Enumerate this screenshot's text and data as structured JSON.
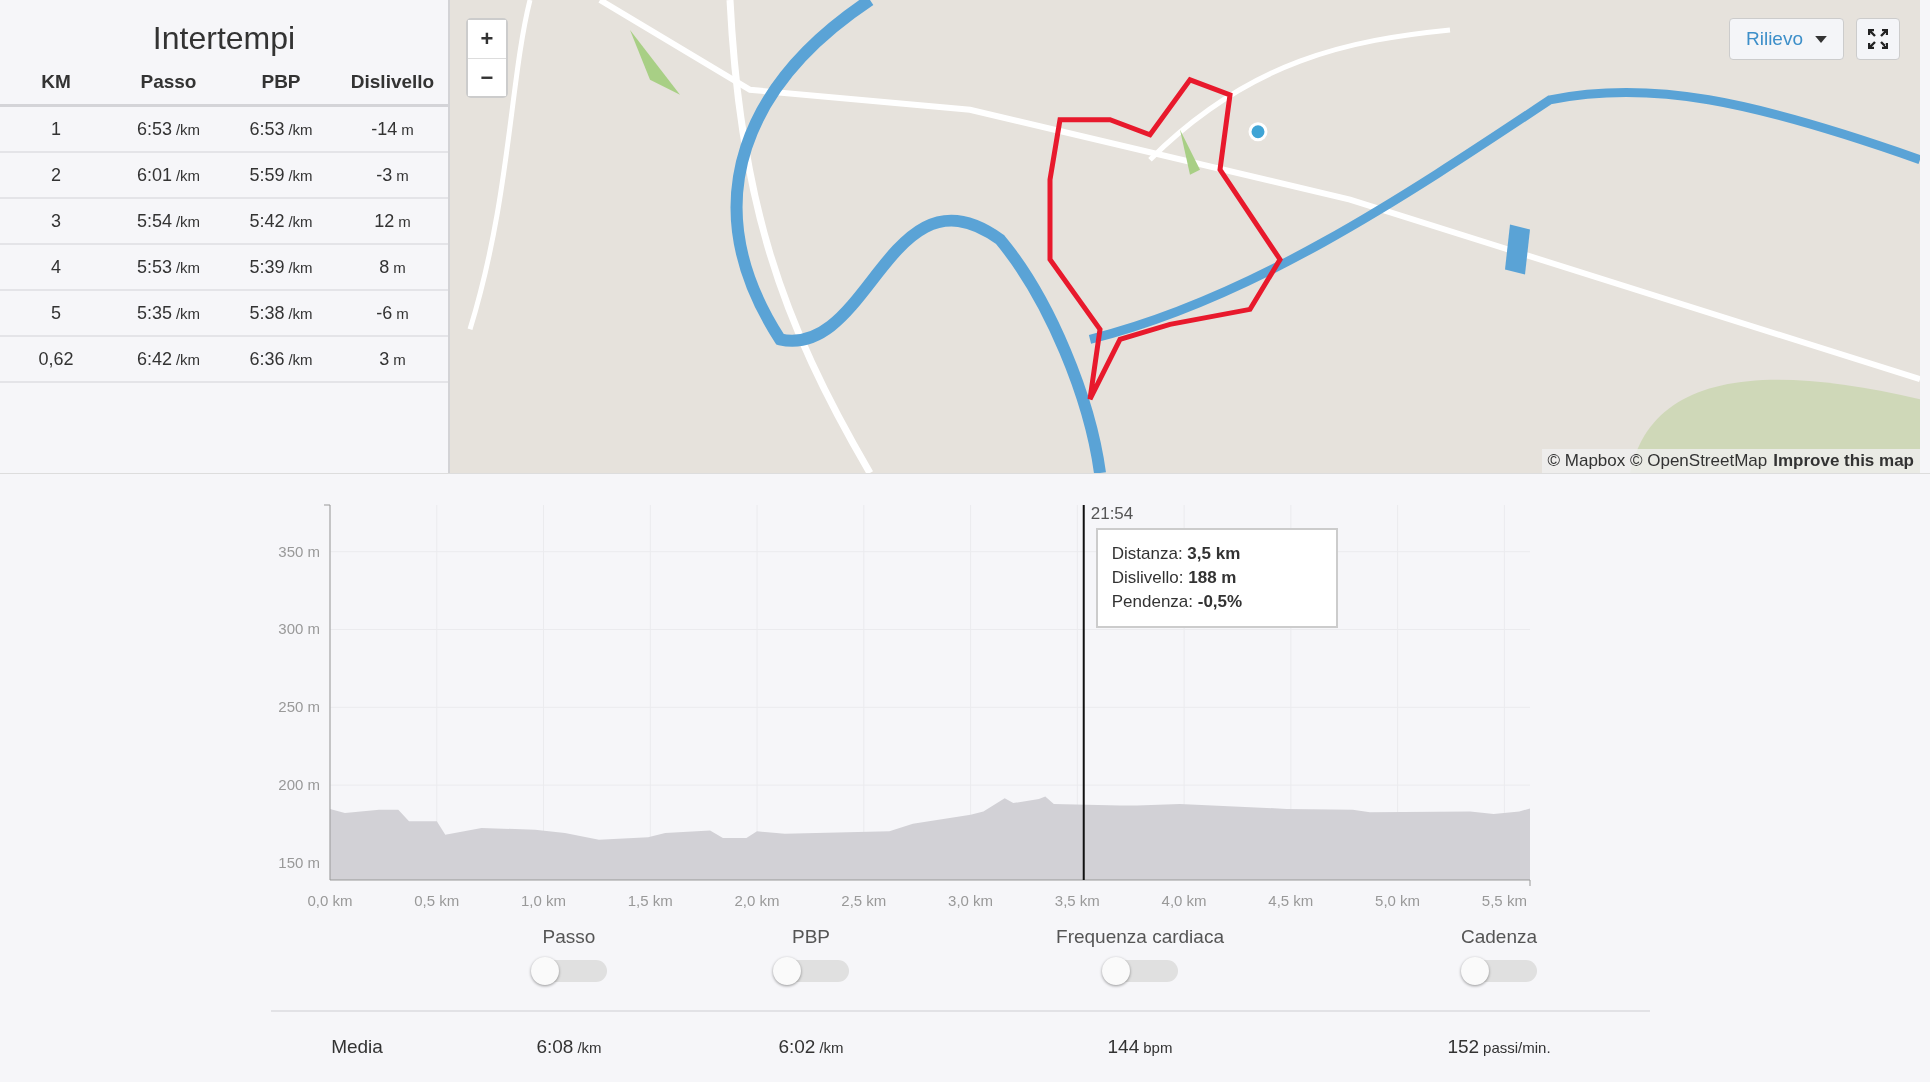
{
  "splits": {
    "title": "Intertempi",
    "columns": [
      "KM",
      "Passo",
      "PBP",
      "Dislivello"
    ],
    "rows": [
      {
        "cells": [
          {
            "value": "1"
          },
          {
            "value": "6:53",
            "unit": "/km"
          },
          {
            "value": "6:53",
            "unit": "/km"
          },
          {
            "value": "-14",
            "unit": "m"
          }
        ]
      },
      {
        "cells": [
          {
            "value": "2"
          },
          {
            "value": "6:01",
            "unit": "/km"
          },
          {
            "value": "5:59",
            "unit": "/km"
          },
          {
            "value": "-3",
            "unit": "m"
          }
        ]
      },
      {
        "cells": [
          {
            "value": "3"
          },
          {
            "value": "5:54",
            "unit": "/km"
          },
          {
            "value": "5:42",
            "unit": "/km"
          },
          {
            "value": "12",
            "unit": "m"
          }
        ]
      },
      {
        "cells": [
          {
            "value": "4"
          },
          {
            "value": "5:53",
            "unit": "/km"
          },
          {
            "value": "5:39",
            "unit": "/km"
          },
          {
            "value": "8",
            "unit": "m"
          }
        ]
      },
      {
        "cells": [
          {
            "value": "5"
          },
          {
            "value": "5:35",
            "unit": "/km"
          },
          {
            "value": "5:38",
            "unit": "/km"
          },
          {
            "value": "-6",
            "unit": "m"
          }
        ]
      },
      {
        "cells": [
          {
            "value": "0,62"
          },
          {
            "value": "6:42",
            "unit": "/km"
          },
          {
            "value": "6:36",
            "unit": "/km"
          },
          {
            "value": "3",
            "unit": "m"
          }
        ]
      }
    ]
  },
  "map": {
    "kind": "picture",
    "zoom_in": "+",
    "zoom_out": "−",
    "layer_button": "Rilievo",
    "attribution": "© Mapbox © OpenStreetMap",
    "improve_link": "Improve this map"
  },
  "elevation": {
    "chart_data": {
      "type": "area",
      "xlim": [
        0,
        5.62
      ],
      "ylim": [
        139,
        380
      ],
      "x": [
        0,
        0.07,
        0.23,
        0.32,
        0.37,
        0.5,
        0.54,
        0.71,
        0.96,
        1.1,
        1.26,
        1.49,
        1.57,
        1.78,
        1.84,
        1.95,
        2.0,
        2.13,
        2.62,
        2.73,
        3.0,
        3.06,
        3.16,
        3.2,
        3.32,
        3.35,
        3.39,
        3.7,
        3.78,
        3.98,
        4.48,
        4.79,
        4.87,
        5.34,
        5.45,
        5.57,
        5.62
      ],
      "grid": true,
      "series": [
        {
          "color": "#d2d1d6",
          "values": [
            184.7,
            182,
            184.1,
            184.1,
            176.7,
            176.7,
            168.1,
            172.4,
            171.3,
            169.2,
            164.9,
            166.5,
            169.2,
            170.8,
            166,
            166,
            170.3,
            168.7,
            170.3,
            175.1,
            180.9,
            183.1,
            191.6,
            188.4,
            191.1,
            192.7,
            187.9,
            186.8,
            186.8,
            187.9,
            184.7,
            184.1,
            182.5,
            183.1,
            181.5,
            183,
            185
          ]
        }
      ],
      "xticks": [
        {
          "value": 0,
          "label": "0,0 km"
        },
        {
          "value": 0.5,
          "label": "0,5 km"
        },
        {
          "value": 1,
          "label": "1,0 km"
        },
        {
          "value": 1.5,
          "label": "1,5 km"
        },
        {
          "value": 2,
          "label": "2,0 km"
        },
        {
          "value": 2.5,
          "label": "2,5 km"
        },
        {
          "value": 3,
          "label": "3,0 km"
        },
        {
          "value": 3.5,
          "label": "3,5 km"
        },
        {
          "value": 4,
          "label": "4,0 km"
        },
        {
          "value": 4.5,
          "label": "4,5 km"
        },
        {
          "value": 5,
          "label": "5,0 km"
        },
        {
          "value": 5.5,
          "label": "5,5 km"
        }
      ],
      "yticks": [
        {
          "value": 150,
          "label": "150 m"
        },
        {
          "value": 200,
          "label": "200 m"
        },
        {
          "value": 250,
          "label": "250 m"
        },
        {
          "value": 300,
          "label": "300 m"
        },
        {
          "value": 350,
          "label": "350 m"
        }
      ],
      "ref_lines": [
        {
          "axis": "x",
          "value": 3.53
        }
      ]
    },
    "tooltip": {
      "time": "21:54",
      "lines": [
        "Distanza: **3,5 km**",
        "Dislivello: **188 m**",
        "Pendenza: **-0,5%**"
      ]
    }
  },
  "metrics": {
    "toggles": [
      {
        "label": "Passo",
        "on": false
      },
      {
        "label": "PBP",
        "on": false
      },
      {
        "label": "Frequenza cardiaca",
        "on": false
      },
      {
        "label": "Cadenza",
        "on": false
      }
    ],
    "summary": {
      "label": "Media",
      "values": [
        {
          "value": "6:08",
          "unit": "/km"
        },
        {
          "value": "6:02",
          "unit": "/km"
        },
        {
          "value": "144",
          "unit": "bpm"
        },
        {
          "value": "152",
          "unit": "passi/min."
        }
      ]
    }
  }
}
